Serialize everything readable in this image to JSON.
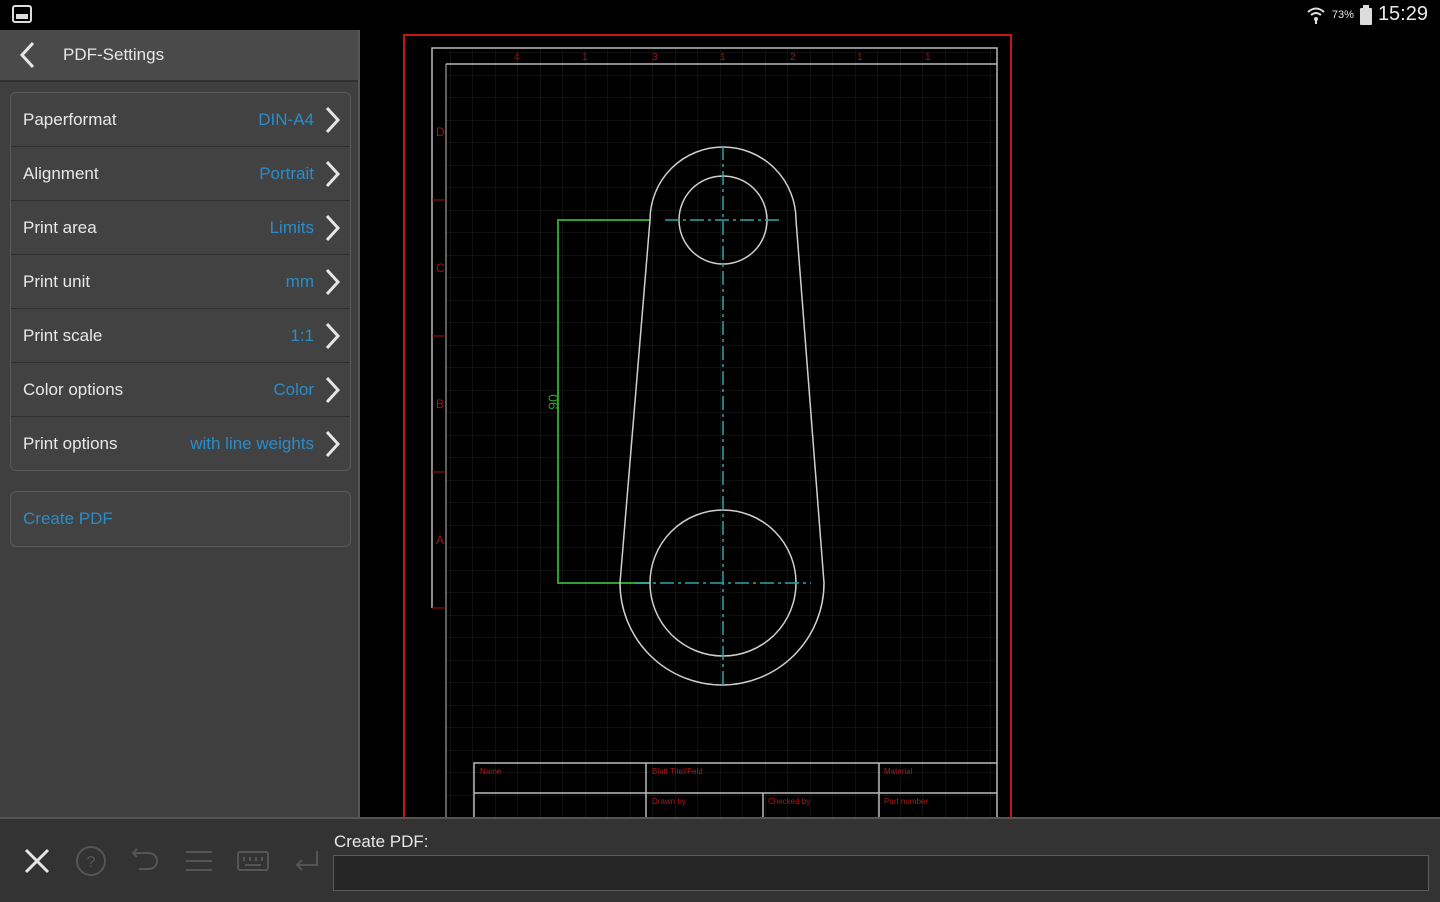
{
  "status_bar": {
    "battery_pct": "73%",
    "time": "15:29",
    "icons": [
      "app-icon",
      "wifi-icon",
      "battery-icon"
    ]
  },
  "panel": {
    "title": "PDF-Settings",
    "settings": [
      {
        "label": "Paperformat",
        "value": "DIN-A4"
      },
      {
        "label": "Alignment",
        "value": "Portrait"
      },
      {
        "label": "Print area",
        "value": "Limits"
      },
      {
        "label": "Print unit",
        "value": "mm"
      },
      {
        "label": "Print scale",
        "value": "1:1"
      },
      {
        "label": "Color options",
        "value": "Color"
      },
      {
        "label": "Print options",
        "value": "with line weights"
      }
    ],
    "create_button": "Create PDF"
  },
  "drawing": {
    "dimension": "90",
    "column_marks": [
      "4",
      "1",
      "3",
      "1",
      "2",
      "1",
      "1"
    ],
    "row_marks": [
      "D",
      "C",
      "B",
      "A"
    ],
    "title_block": [
      "Name",
      "Blatt Titel/Feld",
      "Material",
      "Drawn by",
      "Checked by",
      "Part number"
    ]
  },
  "bottom_bar": {
    "command_label": "Create PDF:",
    "command_value": "",
    "tools": [
      "close-icon",
      "help-icon",
      "undo-icon",
      "list-icon",
      "keyboard-icon",
      "enter-icon"
    ]
  },
  "colors": {
    "accent": "#2a8cc8",
    "panel_bg": "#3f3f3f",
    "frame_red": "#c01818",
    "dimension_green": "#2fa02f",
    "centerline_cyan": "#2aa7a7"
  }
}
